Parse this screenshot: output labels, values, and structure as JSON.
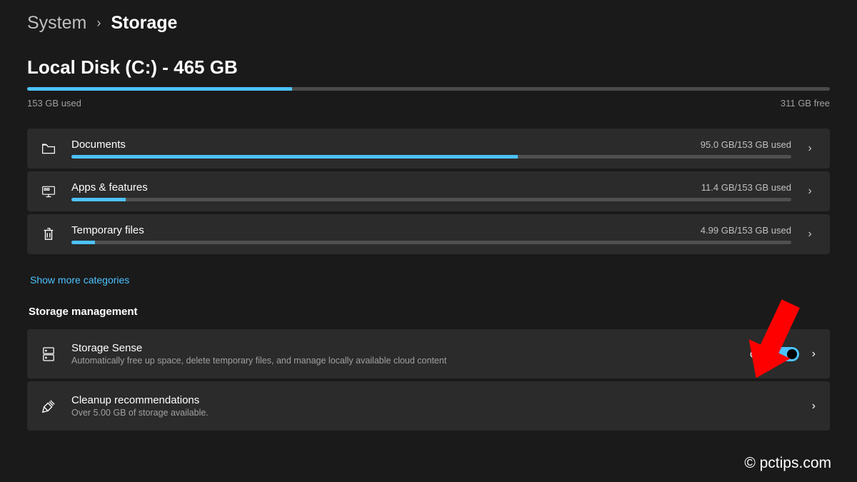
{
  "breadcrumb": {
    "parent": "System",
    "current": "Storage"
  },
  "disk": {
    "title": "Local Disk (C:) - 465 GB",
    "used": "153 GB used",
    "free": "311 GB free",
    "fill_pct": 33
  },
  "categories": [
    {
      "icon": "documents-icon",
      "label": "Documents",
      "usage": "95.0 GB/153 GB used",
      "fill_pct": 62
    },
    {
      "icon": "apps-icon",
      "label": "Apps & features",
      "usage": "11.4 GB/153 GB used",
      "fill_pct": 7.5
    },
    {
      "icon": "trash-icon",
      "label": "Temporary files",
      "usage": "4.99 GB/153 GB used",
      "fill_pct": 3.3
    }
  ],
  "show_more": "Show more categories",
  "section_mgmt": "Storage management",
  "storage_sense": {
    "title": "Storage Sense",
    "sub": "Automatically free up space, delete temporary files, and manage locally available cloud content",
    "state_label": "On"
  },
  "cleanup": {
    "title": "Cleanup recommendations",
    "sub": "Over 5.00 GB of storage available."
  },
  "watermark": "© pctips.com",
  "colors": {
    "accent": "#4cc2ff"
  }
}
